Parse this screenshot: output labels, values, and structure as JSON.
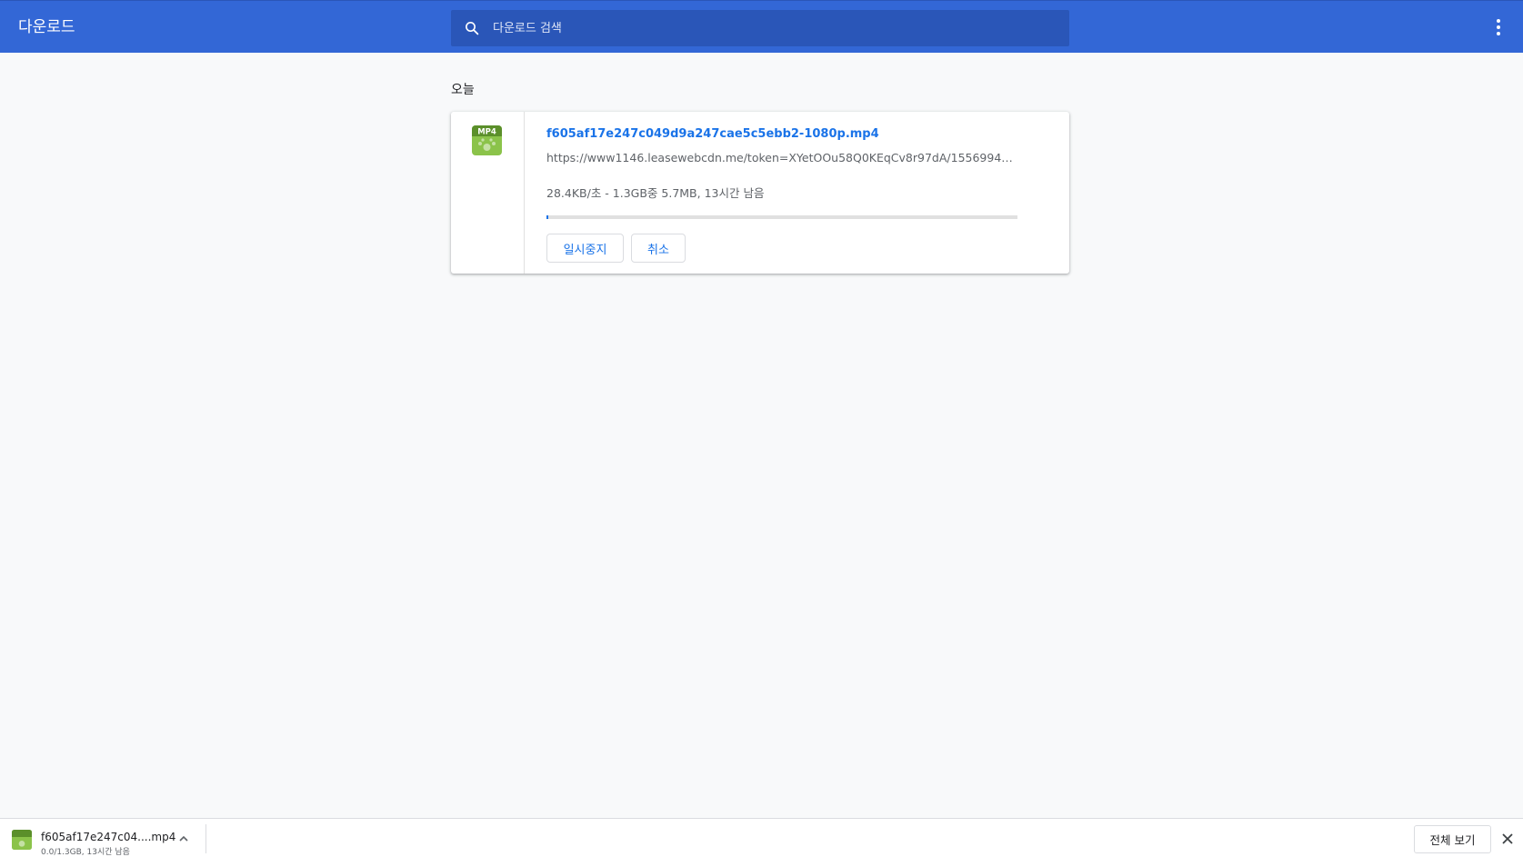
{
  "header": {
    "title": "다운로드",
    "search_placeholder": "다운로드 검색",
    "search_value": "",
    "menu_icon": "more-vert-icon",
    "accent_color": "#3367d6"
  },
  "section": {
    "label": "오늘"
  },
  "download": {
    "file_type_label": "MP4",
    "file_name": "f605af17e247c049d9a247cae5c5ebb2-1080p.mp4",
    "url": "https://www1146.leasewebcdn.me/token=XYetOOu58Q0KEqCv8r97dA/1556994487/0.0...",
    "status": "28.4KB/초 - 1.3GB중 5.7MB, 13시간 남음",
    "progress_fraction": 0.0044,
    "pause_label": "일시중지",
    "cancel_label": "취소"
  },
  "shelf": {
    "item_name": "f605af17e247c04....mp4",
    "item_sub": "0.0/1.3GB, 13시간 남음",
    "show_all_label": "전체 보기"
  }
}
